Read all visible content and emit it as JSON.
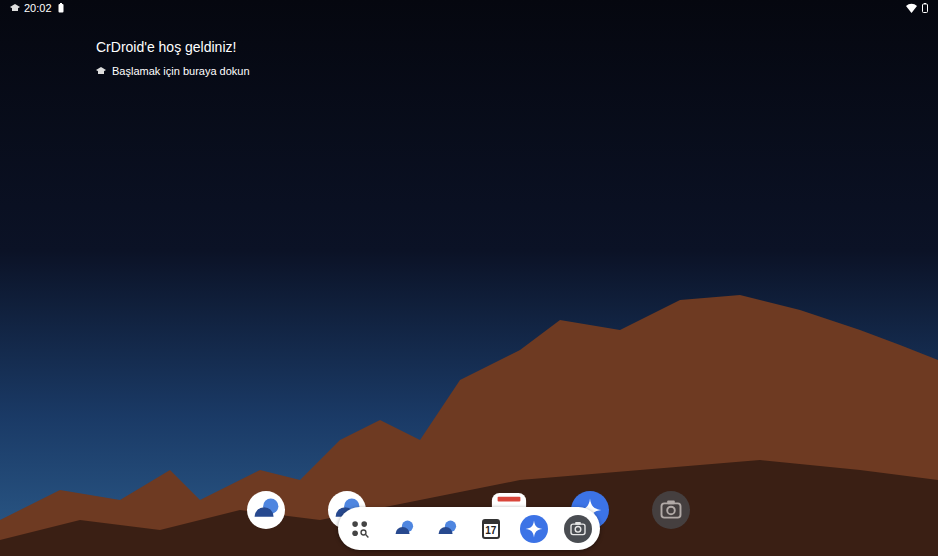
{
  "status_bar": {
    "time": "20:02"
  },
  "welcome": {
    "title": "CrDroid'e hoş geldiniz!",
    "subtitle": "Başlamak için buraya dokun"
  },
  "home_row": [
    {
      "kind": "messages"
    },
    {
      "kind": "messages"
    },
    {
      "kind": "spacer"
    },
    {
      "kind": "calendar"
    },
    {
      "kind": "assistant"
    },
    {
      "kind": "camera"
    }
  ],
  "taskbar": [
    {
      "kind": "app-drawer"
    },
    {
      "kind": "messages"
    },
    {
      "kind": "messages"
    },
    {
      "kind": "calendar",
      "label": "17"
    },
    {
      "kind": "assistant"
    },
    {
      "kind": "camera"
    }
  ]
}
